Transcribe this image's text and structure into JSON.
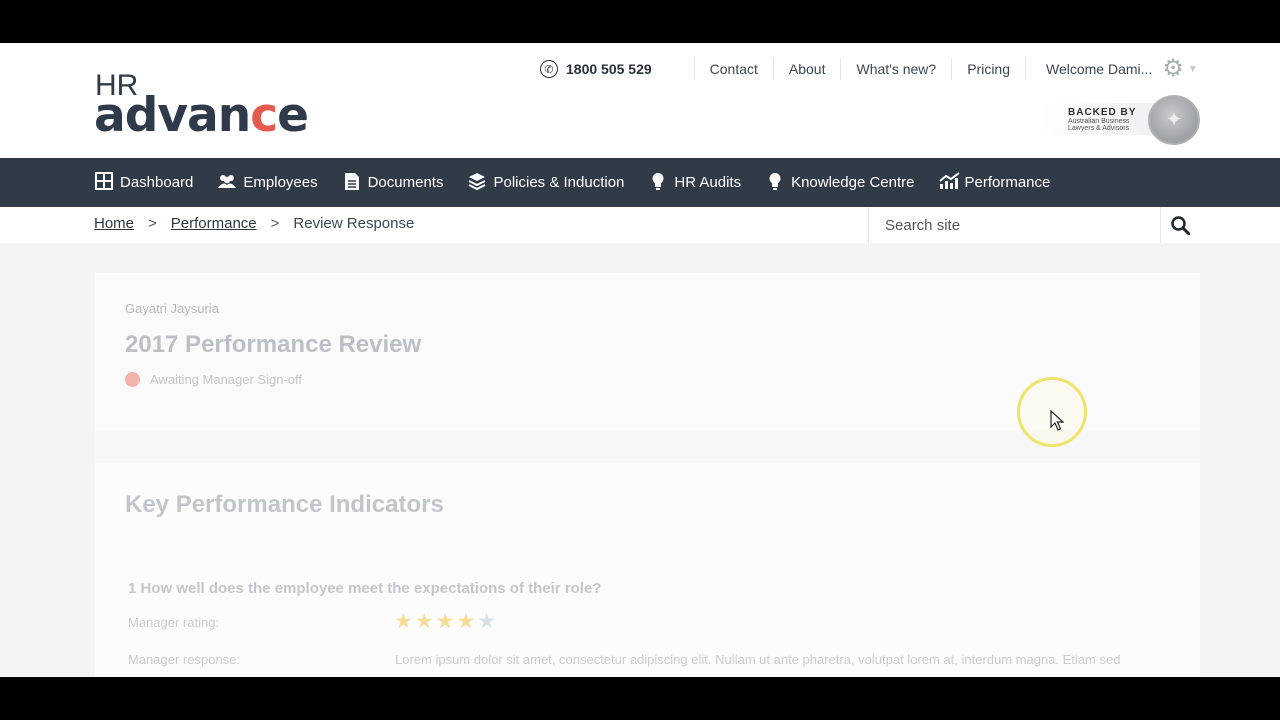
{
  "logo": {
    "line1": "HR",
    "line2_part1": "advan",
    "line2_accent": "c",
    "line2_part2": "e"
  },
  "topbar": {
    "phone": "1800 505 529",
    "links": [
      "Contact",
      "About",
      "What's new?",
      "Pricing"
    ],
    "welcome": "Welcome Dami..."
  },
  "badge": {
    "line1": "BACKED BY",
    "line2": "Australian Business Lawyers & Advisors"
  },
  "nav": {
    "items": [
      {
        "label": "Dashboard",
        "icon": "dashboard-icon"
      },
      {
        "label": "Employees",
        "icon": "employees-icon"
      },
      {
        "label": "Documents",
        "icon": "document-icon"
      },
      {
        "label": "Policies & Induction",
        "icon": "layers-icon"
      },
      {
        "label": "HR Audits",
        "icon": "lightbulb-icon"
      },
      {
        "label": "Knowledge Centre",
        "icon": "lightbulb-icon"
      },
      {
        "label": "Performance",
        "icon": "chart-icon"
      }
    ]
  },
  "breadcrumb": {
    "home": "Home",
    "performance": "Performance",
    "current": "Review Response",
    "sep": ">"
  },
  "search": {
    "placeholder": "Search site"
  },
  "review": {
    "employee": "Gayatri Jaysuria",
    "title": "2017 Performance Review",
    "status": "Awaiting Manager Sign-off",
    "status_color": "#f1b3ac"
  },
  "kpi": {
    "title": "Key Performance Indicators",
    "question": "1 How well does the employee meet the expectations of their role?",
    "rating_label": "Manager rating:",
    "rating": 4,
    "rating_max": 5,
    "response_label": "Manager response:",
    "response": "Lorem ipsum dolor sit amet, consectetur adipiscing elit. Nullam ut ante pharetra, volutpat lorem at, interdum magna. Etiam sed"
  },
  "colors": {
    "nav_bg": "#313b48",
    "accent": "#e55a4e",
    "star_on": "#f7dc98",
    "star_off": "#d9e0e5"
  }
}
